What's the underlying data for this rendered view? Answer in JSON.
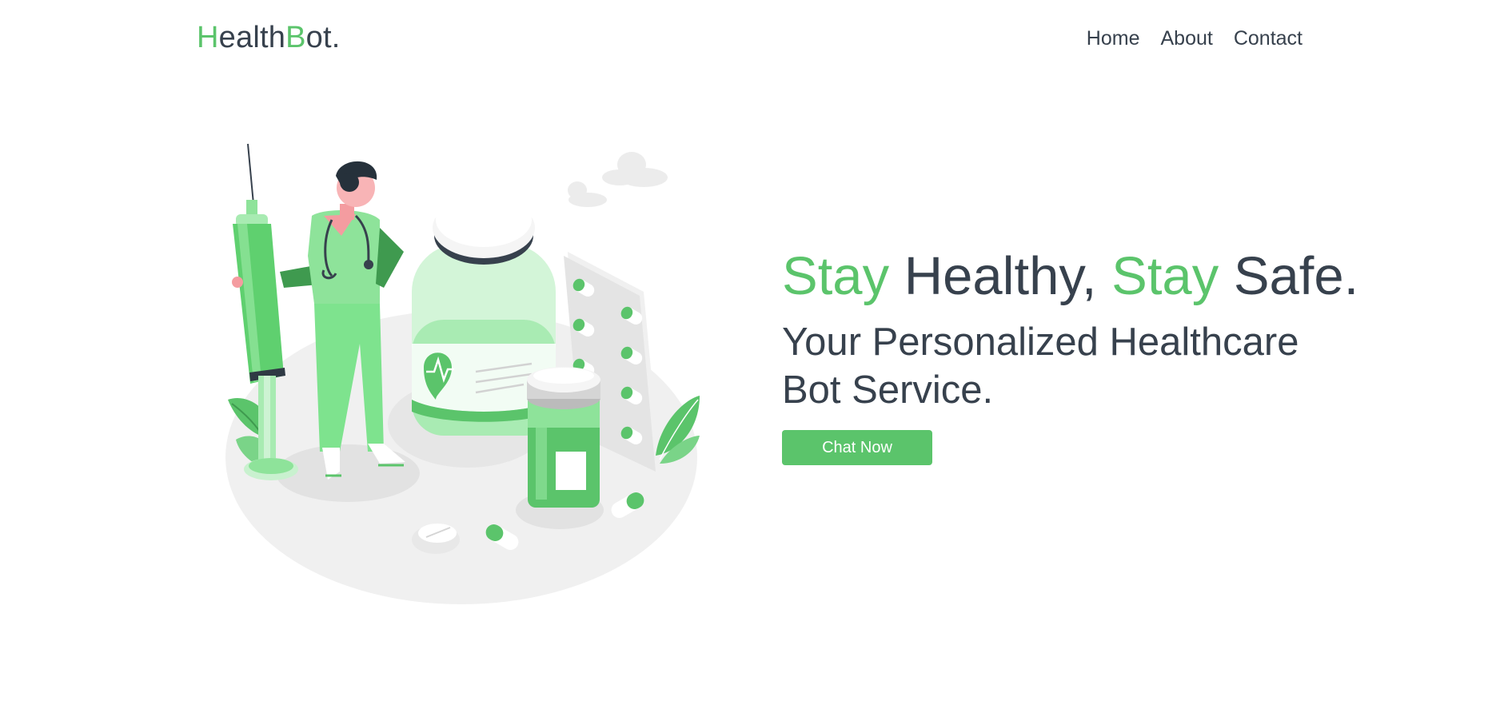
{
  "brand": {
    "part1": "H",
    "part2": "ealth",
    "part3": "B",
    "part4": "ot."
  },
  "nav": {
    "items": [
      {
        "label": "Home"
      },
      {
        "label": "About"
      },
      {
        "label": "Contact"
      }
    ]
  },
  "hero": {
    "headline": {
      "w1": "Stay",
      "w2": " Healthy, ",
      "w3": "Stay",
      "w4": " Safe."
    },
    "subheadline": "Your Personalized Healthcare Bot Service.",
    "cta_label": "Chat Now"
  },
  "colors": {
    "accent": "#5bc46b",
    "text": "#37414d",
    "background": "#ffffff"
  },
  "illustration": {
    "subject": "doctor-with-syringe-and-medicine-icon"
  }
}
